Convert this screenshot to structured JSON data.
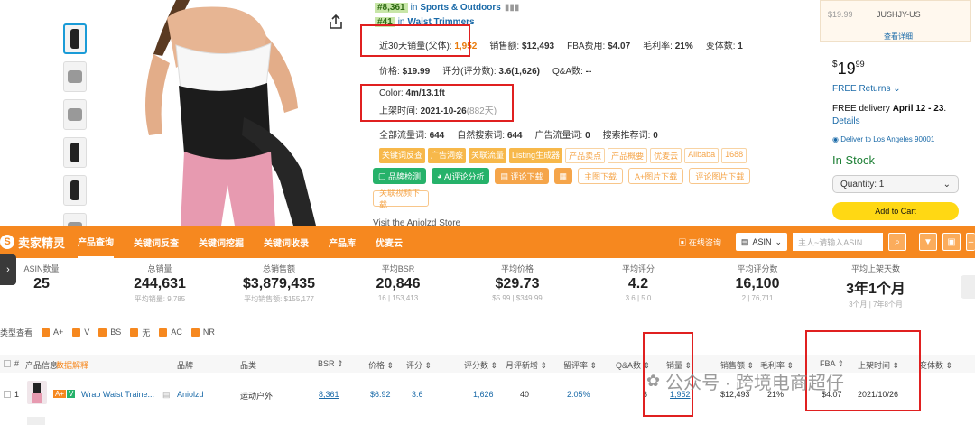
{
  "product": {
    "rank_main": "#8,361",
    "rank_main_cat": "Sports & Outdoors",
    "rank_sub": "#41",
    "rank_sub_cat": "Waist Trimmers",
    "rank_prefix": "in",
    "stats1": {
      "sales30_label": "近30天销量(父体):",
      "sales30_value": "1,952",
      "revenue_label": "销售额:",
      "revenue_value": "$12,493",
      "fba_label": "FBA费用:",
      "fba_value": "$4.07",
      "margin_label": "毛利率:",
      "margin_value": "21%",
      "variants_label": "变体数:",
      "variants_value": "1"
    },
    "stats2": {
      "price_label": "价格:",
      "price_value": "$19.99",
      "rating_label": "评分(评分数):",
      "rating_value": "3.6(1,626)",
      "qa_label": "Q&A数:",
      "qa_value": "--"
    },
    "color_label": "Color:",
    "color_value": "4m/13.1ft",
    "listed_label": "上架时间:",
    "listed_value": "2021-10-26",
    "listed_days": "(882天)",
    "stats3": {
      "all_traffic_label": "全部流量词:",
      "all_traffic_value": "644",
      "natural_label": "自然搜索词:",
      "natural_value": "644",
      "ad_label": "广告流量词:",
      "ad_value": "0",
      "rec_label": "搜索推荐词:",
      "rec_value": "0"
    },
    "tags": [
      "关键词反查",
      "广告洞察",
      "关联流量",
      "Listing生成器",
      "产品卖点",
      "产品概要",
      "优麦云",
      "Alibaba",
      "1688"
    ],
    "buttons": {
      "brand_check": "品牌检测",
      "ai_review": "AI评论分析",
      "review_download": "评论下载",
      "main_image": "主图下载",
      "aplus_image": "A+图片下载",
      "review_image": "评论图片下载",
      "related_video": "关联视频下载"
    },
    "visit_store": "Visit the Aniolzd Store"
  },
  "buybox": {
    "top_price": "$19.99",
    "seller": "JUSHJY-US",
    "view_detail": "查看详细",
    "price_whole": "19",
    "price_cents": "99",
    "currency": "$",
    "free_returns": "FREE Returns",
    "delivery_prefix": "FREE delivery",
    "delivery_dates": "April 12 - 23",
    "details": "Details",
    "deliver_to": "Deliver to Los Angeles 90001",
    "in_stock": "In Stock",
    "quantity": "Quantity: 1",
    "add_to_cart": "Add to Cart"
  },
  "nav": {
    "logo": "卖家精灵",
    "items": [
      "产品查询",
      "关键词反查",
      "关键词挖掘",
      "关键词收录",
      "产品库",
      "优麦云"
    ],
    "search_label": "在线咨询",
    "asin_label": "ASIN",
    "asin_placeholder": "主人~请输入ASIN"
  },
  "stats": [
    {
      "label": "ASIN数量",
      "value": "25",
      "sub": ""
    },
    {
      "label": "总销量",
      "value": "244,631",
      "sub": "平均销量: 9,785"
    },
    {
      "label": "总销售额",
      "value": "$3,879,435",
      "sub": "平均销售额: $155,177"
    },
    {
      "label": "平均BSR",
      "value": "20,846",
      "sub": "16 | 153,413"
    },
    {
      "label": "平均价格",
      "value": "$29.73",
      "sub": "$5.99 | $349.99"
    },
    {
      "label": "平均评分",
      "value": "4.2",
      "sub": "3.6 | 5.0"
    },
    {
      "label": "平均评分数",
      "value": "16,100",
      "sub": "2 | 76,711"
    },
    {
      "label": "平均上架天数",
      "value": "3年1个月",
      "sub": "3个月 | 7年8个月"
    }
  ],
  "filters": {
    "label": "类型查看",
    "options": [
      "A+",
      "V",
      "BS",
      "无",
      "AC",
      "NR"
    ]
  },
  "table": {
    "headers": [
      "#",
      "产品信息",
      "数据解释",
      "品牌",
      "品类",
      "BSR",
      "价格",
      "评分",
      "评分数",
      "月评新增",
      "留评率",
      "Q&A数",
      "销量",
      "销售额",
      "毛利率",
      "FBA",
      "上架时间",
      "变体数"
    ],
    "row": {
      "index": "1",
      "badge1": "A+",
      "badge2": "V",
      "title": "Wrap Waist Traine...",
      "brand": "Aniolzd",
      "category": "运动户外",
      "bsr": "8,361",
      "price": "$6.92",
      "rating": "3.6",
      "reviews": "1,626",
      "monthly_new": "40",
      "review_rate": "2.05%",
      "qa": "6",
      "sales": "1,952",
      "revenue": "$12,493",
      "margin": "21%",
      "fba": "$4.07",
      "listed": "2021/10/26"
    }
  },
  "watermark": "公众号 · 跨境电商超仔"
}
